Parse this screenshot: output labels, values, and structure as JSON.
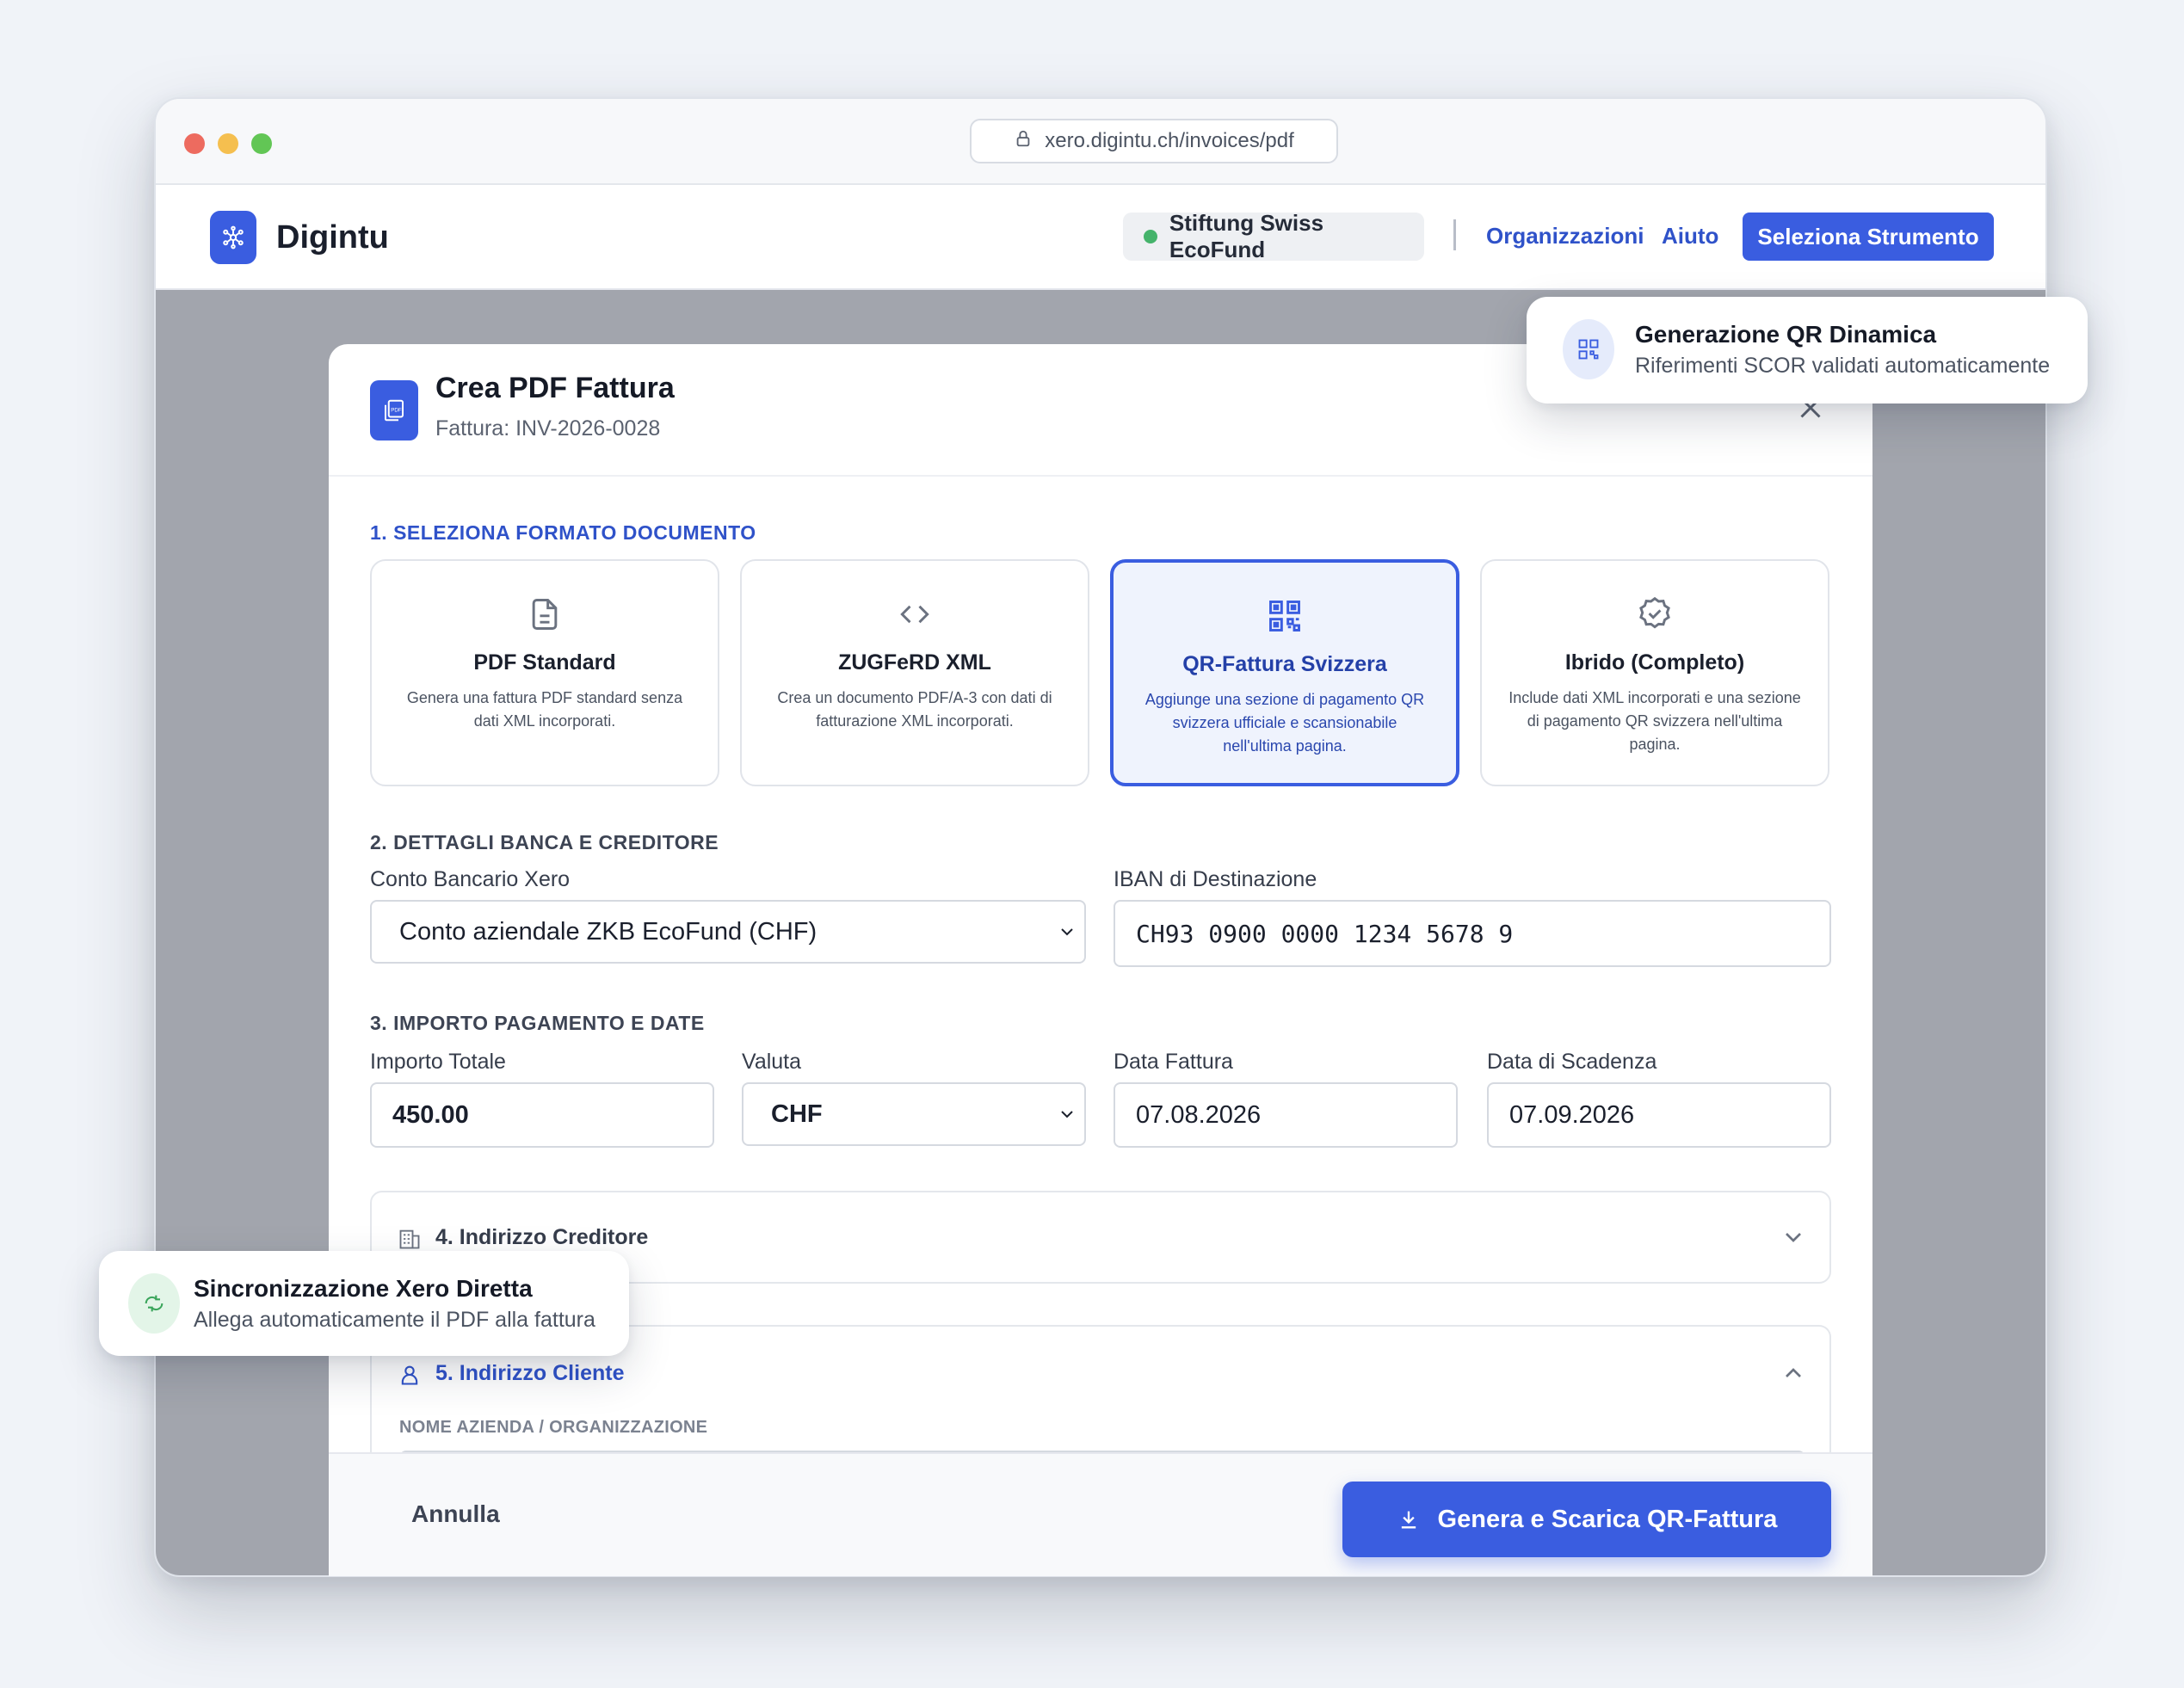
{
  "browser": {
    "url": "xero.digintu.ch/invoices/pdf"
  },
  "header": {
    "brand": "Digintu",
    "org_name": "Stiftung Swiss EcoFund",
    "nav_organizations": "Organizzazioni",
    "nav_help": "Aiuto",
    "select_tool": "Seleziona Strumento",
    "status_color": "#45b36b"
  },
  "modal": {
    "title": "Crea PDF Fattura",
    "subtitle": "Fattura: INV-2026-0028",
    "section1": "1. SELEZIONA FORMATO DOCUMENTO",
    "formats": [
      {
        "title": "PDF Standard",
        "description": "Genera una fattura PDF standard senza dati XML incorporati.",
        "icon": "document-icon",
        "selected": false
      },
      {
        "title": "ZUGFeRD XML",
        "description": "Crea un documento PDF/A-3 con dati di fatturazione XML incorporati.",
        "icon": "code-icon",
        "selected": false
      },
      {
        "title": "QR-Fattura Svizzera",
        "description": "Aggiunge una sezione di pagamento QR svizzera ufficiale e scansionabile nell'ultima pagina.",
        "icon": "qr-code-icon",
        "selected": true
      },
      {
        "title": "Ibrido (Completo)",
        "description": "Include dati XML incorporati e una sezione di pagamento QR svizzera nell'ultima pagina.",
        "icon": "verified-badge-icon",
        "selected": false
      }
    ],
    "section2": "2. DETTAGLI BANCA E CREDITORE",
    "bank_account_label": "Conto Bancario Xero",
    "bank_account_value": "Conto aziendale ZKB EcoFund (CHF)",
    "iban_label": "IBAN di Destinazione",
    "iban_value": "CH93 0900 0000 1234 5678 9",
    "section3": "3. IMPORTO PAGAMENTO E DATE",
    "amount_label": "Importo Totale",
    "amount_value": "450.00",
    "currency_label": "Valuta",
    "currency_value": "CHF",
    "invoice_date_label": "Data Fattura",
    "invoice_date_value": "07.08.2026",
    "due_date_label": "Data di Scadenza",
    "due_date_value": "07.09.2026",
    "accordion_creditor": "4. Indirizzo Creditore",
    "accordion_client": "5. Indirizzo Cliente",
    "company_name_label": "NOME AZIENDA / ORGANIZZAZIONE",
    "cancel": "Annulla",
    "generate": "Genera e Scarica QR-Fattura"
  },
  "toasts": {
    "qr_title": "Generazione QR Dinamica",
    "qr_sub": "Riferimenti SCOR validati automaticamente",
    "sync_title": "Sincronizzazione Xero Diretta",
    "sync_sub": "Allega automaticamente il PDF alla fattura"
  },
  "colors": {
    "accent": "#3a5de0",
    "accent_text": "#2f52c9"
  }
}
